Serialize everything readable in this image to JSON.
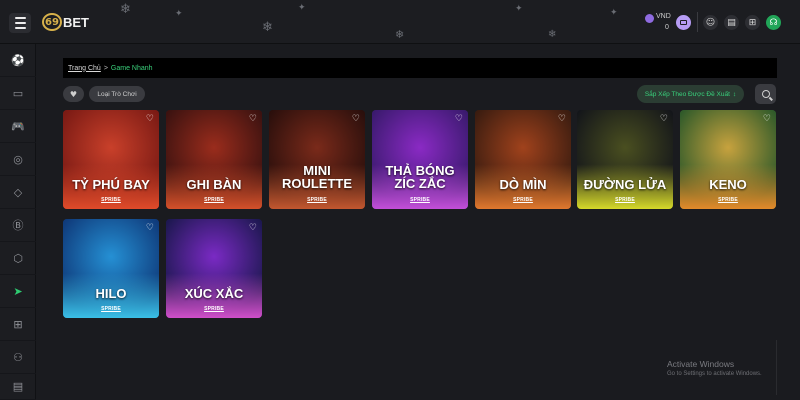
{
  "header": {
    "logo_mark": "69",
    "logo_text": "BET",
    "currency": "VND",
    "balance": "0"
  },
  "icons": {
    "menu": "menu-icon",
    "wallet": "wallet-icon",
    "avatar": "avatar-icon",
    "clipboard": "clipboard-icon",
    "gift": "gift-icon",
    "support": "headset-icon",
    "heart": "heart-icon",
    "search": "search-icon"
  },
  "sidebar": {
    "items": [
      {
        "name": "soccer",
        "glyph": "⚽"
      },
      {
        "name": "monitor",
        "glyph": "▭"
      },
      {
        "name": "gamepad",
        "glyph": "🎮"
      },
      {
        "name": "chip",
        "glyph": "◎"
      },
      {
        "name": "diamond",
        "glyph": "◇"
      },
      {
        "name": "coin",
        "glyph": "Ⓑ"
      },
      {
        "name": "dice",
        "glyph": "⬡"
      },
      {
        "name": "send",
        "glyph": "➤"
      },
      {
        "name": "gift",
        "glyph": "⊞"
      },
      {
        "name": "user-add",
        "glyph": "⚇"
      },
      {
        "name": "document",
        "glyph": "▤"
      }
    ]
  },
  "breadcrumb": {
    "home": "Trang Chủ",
    "separator": ">",
    "current": "Game Nhanh"
  },
  "filters": {
    "favorite_glyph": "♥",
    "game_type": "Loại Trò Chơi",
    "sort": "Sắp Xếp Theo Được Đề Xuất",
    "sort_glyph": "↕"
  },
  "games": [
    {
      "title": "TỶ PHÚ BAY",
      "provider": "SPRIBE",
      "colors": [
        "#7a1a14",
        "#c9402a",
        "#e04b2a"
      ]
    },
    {
      "title": "GHI BÀN",
      "provider": "SPRIBE",
      "colors": [
        "#3b1210",
        "#9a2c1c",
        "#d4502a"
      ]
    },
    {
      "title": "MINI ROULETTE",
      "provider": "SPRIBE",
      "colors": [
        "#2a0f0c",
        "#7a2a1a",
        "#c2572f"
      ]
    },
    {
      "title": "THẢ BÓNG ZÍC ZẮC",
      "provider": "SPRIBE",
      "colors": [
        "#3a1a6e",
        "#8a2ac4",
        "#c34fd9"
      ]
    },
    {
      "title": "DÒ MÌN",
      "provider": "SPRIBE",
      "colors": [
        "#3a1c10",
        "#a0421c",
        "#e0782e"
      ]
    },
    {
      "title": "ĐƯỜNG LỬA",
      "provider": "SPRIBE",
      "colors": [
        "#14161a",
        "#4a4f20",
        "#d6d92a"
      ]
    },
    {
      "title": "KENO",
      "provider": "SPRIBE",
      "colors": [
        "#2f5a2a",
        "#c7a23e",
        "#e38a2a"
      ]
    },
    {
      "title": "HILO",
      "provider": "SPRIBE",
      "colors": [
        "#0f3a7a",
        "#2590d4",
        "#3ac0e6"
      ]
    },
    {
      "title": "XÚC XẮC",
      "provider": "SPRIBE",
      "colors": [
        "#1d1850",
        "#7a2ac4",
        "#d04fc9"
      ]
    }
  ],
  "os_watermark": {
    "title": "Activate Windows",
    "subtitle": "Go to Settings to activate Windows."
  }
}
